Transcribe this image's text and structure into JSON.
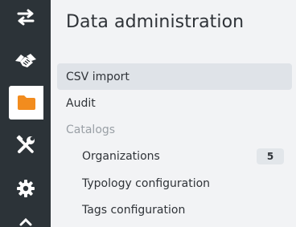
{
  "sidebar": {
    "items": [
      {
        "icon": "swap-arrows-icon",
        "active": false
      },
      {
        "icon": "handshake-icon",
        "active": false
      },
      {
        "icon": "folder-icon",
        "active": true
      },
      {
        "icon": "tools-icon",
        "active": false
      },
      {
        "icon": "gear-icon",
        "active": false
      }
    ],
    "colors": {
      "background": "#2c3338",
      "icon": "#ffffff",
      "active_icon": "#f28c1e"
    }
  },
  "panel": {
    "title": "Data administration",
    "menu": {
      "csv_import": "CSV import",
      "audit": "Audit",
      "catalogs_header": "Catalogs",
      "organizations": "Organizations",
      "organizations_count": "5",
      "typology_configuration": "Typology configuration",
      "tags_configuration": "Tags configuration"
    }
  }
}
